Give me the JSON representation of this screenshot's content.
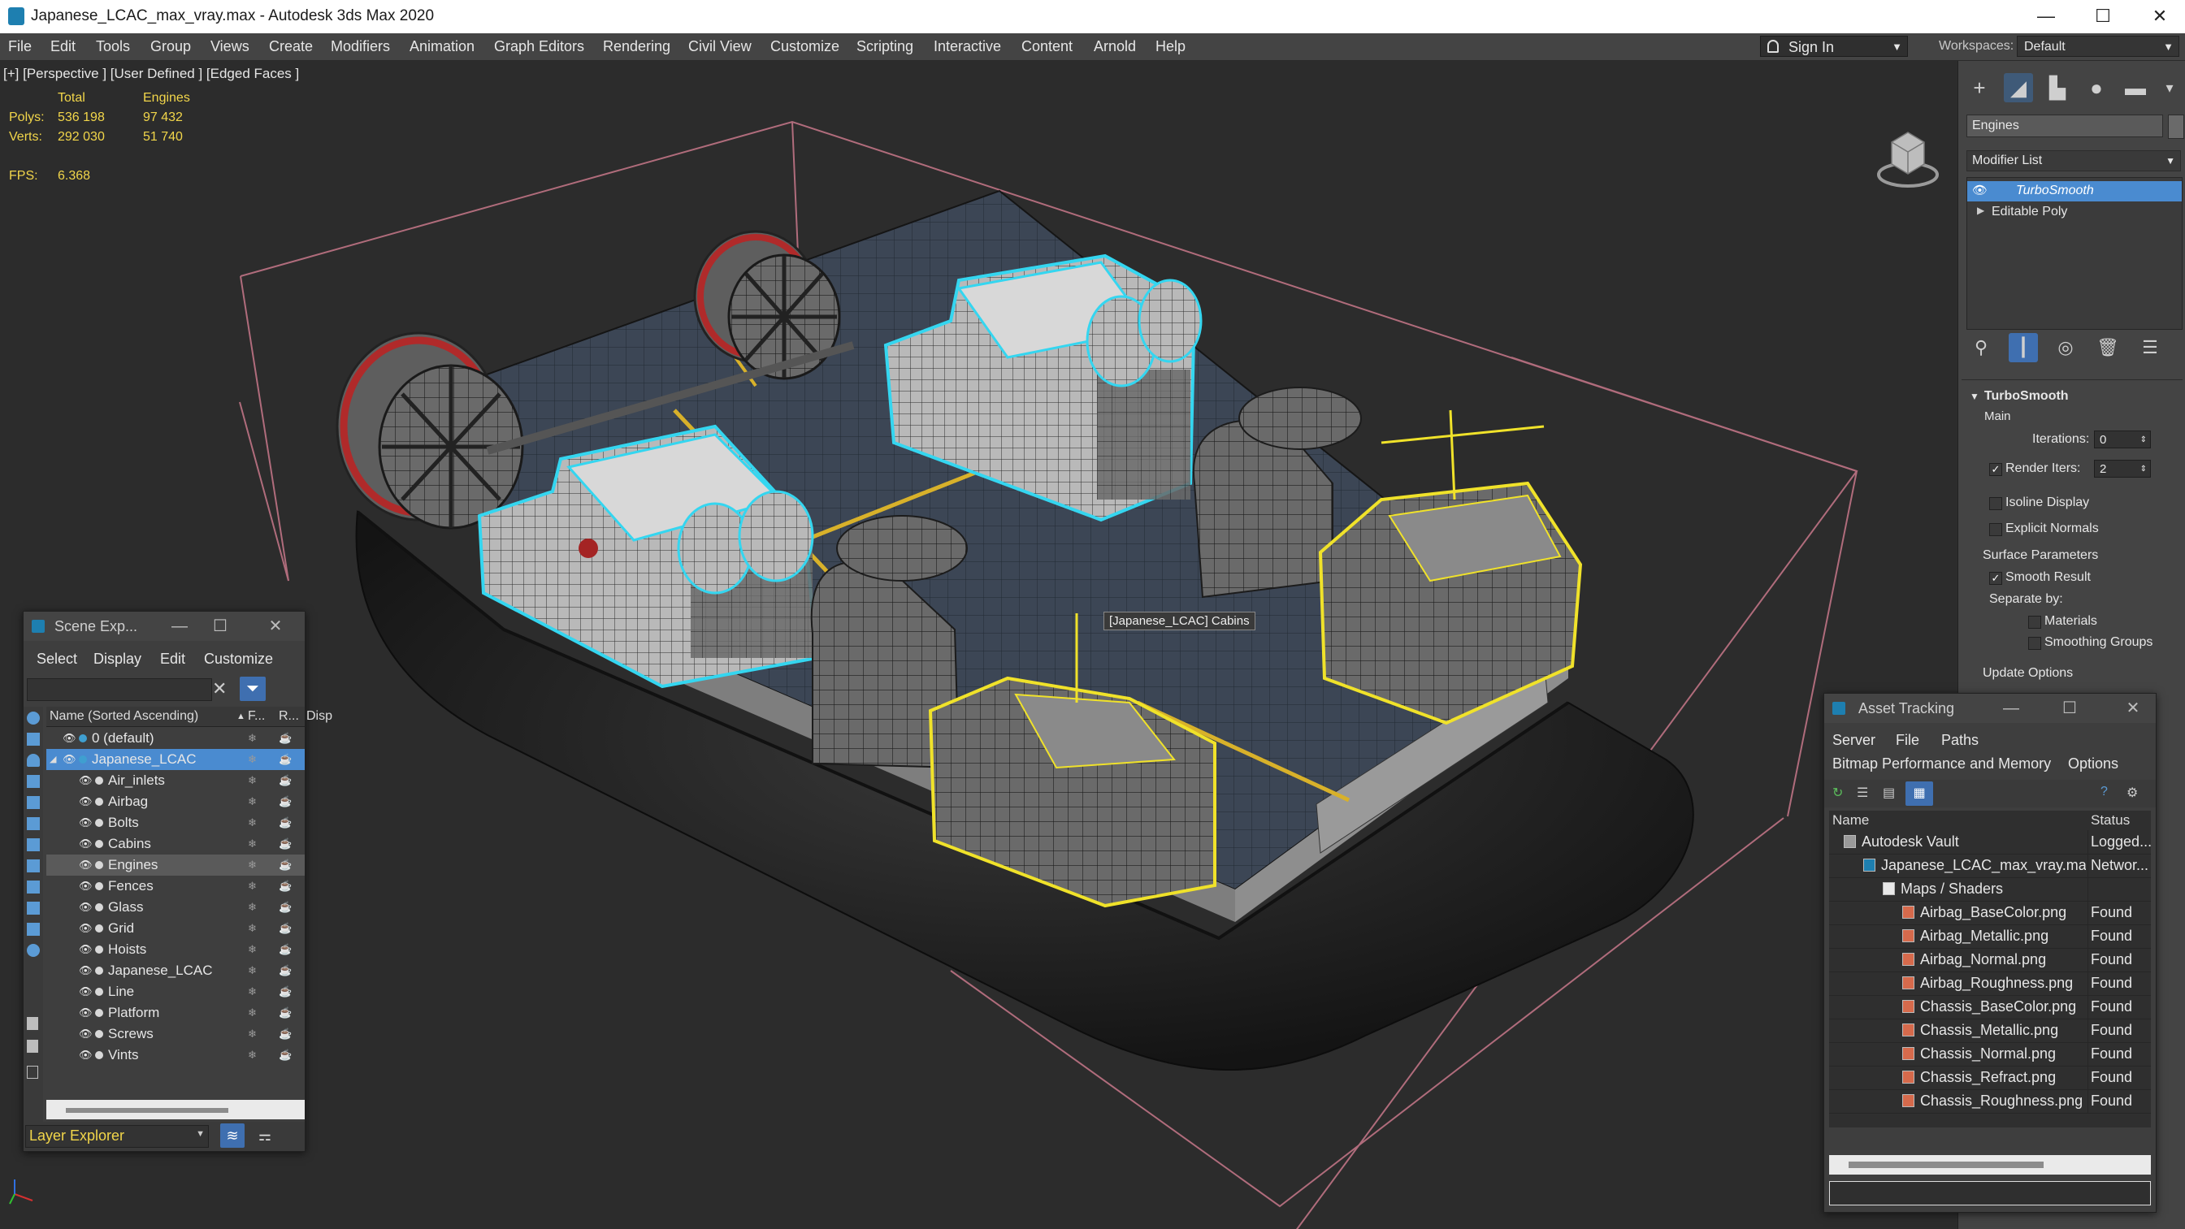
{
  "titlebar": {
    "title": "Japanese_LCAC_max_vray.max - Autodesk 3ds Max 2020",
    "minimize": "—",
    "maximize": "☐",
    "close": "✕"
  },
  "menubar": {
    "items": [
      "File",
      "Edit",
      "Tools",
      "Group",
      "Views",
      "Create",
      "Modifiers",
      "Animation",
      "Graph Editors",
      "Rendering",
      "Civil View",
      "Customize",
      "Scripting",
      "Interactive",
      "Content",
      "Arnold",
      "Help"
    ],
    "signin": "Sign In",
    "workspaces_label": "Workspaces:",
    "workspaces_value": "Default"
  },
  "viewport": {
    "label": "[+] [Perspective ] [User Defined ] [Edged Faces ]",
    "stats": {
      "total_header": "Total",
      "engines_header": "Engines",
      "polys_label": "Polys:",
      "polys_total": "536 198",
      "polys_engines": "97 432",
      "verts_label": "Verts:",
      "verts_total": "292 030",
      "verts_engines": "51 740",
      "fps_label": "FPS:",
      "fps_value": "6.368"
    },
    "tooltip": "[Japanese_LCAC] Cabins"
  },
  "command_panel": {
    "object_name": "Engines",
    "modifier_list": "Modifier List",
    "stack": [
      "TurboSmooth",
      "Editable Poly"
    ],
    "rollout_title": "TurboSmooth",
    "main_label": "Main",
    "iterations_label": "Iterations:",
    "iterations_value": "0",
    "render_iters_label": "Render Iters:",
    "render_iters_value": "2",
    "isoline_display": "Isoline Display",
    "explicit_normals": "Explicit Normals",
    "surface_parameters": "Surface Parameters",
    "smooth_result": "Smooth Result",
    "separate_by": "Separate by:",
    "materials": "Materials",
    "smoothing_groups": "Smoothing Groups",
    "update_options": "Update Options"
  },
  "scene_explorer": {
    "title": "Scene Exp...",
    "menu": [
      "Select",
      "Display",
      "Edit",
      "Customize"
    ],
    "col_name": "Name (Sorted Ascending)",
    "col_f": "F...",
    "col_r": "R...",
    "col_disp": "Disp",
    "rows": [
      {
        "label": "0 (default)",
        "indent": 1
      },
      {
        "label": "Japanese_LCAC",
        "indent": 1
      },
      {
        "label": "Air_inlets",
        "indent": 2
      },
      {
        "label": "Airbag",
        "indent": 2
      },
      {
        "label": "Bolts",
        "indent": 2
      },
      {
        "label": "Cabins",
        "indent": 2
      },
      {
        "label": "Engines",
        "indent": 2
      },
      {
        "label": "Fences",
        "indent": 2
      },
      {
        "label": "Glass",
        "indent": 2
      },
      {
        "label": "Grid",
        "indent": 2
      },
      {
        "label": "Hoists",
        "indent": 2
      },
      {
        "label": "Japanese_LCAC",
        "indent": 2
      },
      {
        "label": "Line",
        "indent": 2
      },
      {
        "label": "Platform",
        "indent": 2
      },
      {
        "label": "Screws",
        "indent": 2
      },
      {
        "label": "Vints",
        "indent": 2
      }
    ],
    "footer_label": "Layer Explorer"
  },
  "asset_tracking": {
    "title": "Asset Tracking",
    "menu1": [
      "Server",
      "File",
      "Paths"
    ],
    "menu2": [
      "Bitmap Performance and Memory",
      "Options"
    ],
    "col_name": "Name",
    "col_status": "Status",
    "rows": [
      {
        "name": "Autodesk Vault",
        "status": "Logged...",
        "indent": 0
      },
      {
        "name": "Japanese_LCAC_max_vray.max",
        "status": "Networ...",
        "indent": 1
      },
      {
        "name": "Maps / Shaders",
        "status": "",
        "indent": 2
      },
      {
        "name": "Airbag_BaseColor.png",
        "status": "Found",
        "indent": 3
      },
      {
        "name": "Airbag_Metallic.png",
        "status": "Found",
        "indent": 3
      },
      {
        "name": "Airbag_Normal.png",
        "status": "Found",
        "indent": 3
      },
      {
        "name": "Airbag_Roughness.png",
        "status": "Found",
        "indent": 3
      },
      {
        "name": "Chassis_BaseColor.png",
        "status": "Found",
        "indent": 3
      },
      {
        "name": "Chassis_Metallic.png",
        "status": "Found",
        "indent": 3
      },
      {
        "name": "Chassis_Normal.png",
        "status": "Found",
        "indent": 3
      },
      {
        "name": "Chassis_Refract.png",
        "status": "Found",
        "indent": 3
      },
      {
        "name": "Chassis_Roughness.png",
        "status": "Found",
        "indent": 3
      }
    ]
  },
  "colors": {
    "selection_cyan": "#34d6f0",
    "selection_yellow": "#f0e22a",
    "stat_yellow": "#f2d64a",
    "active_blue": "#4a8bd0"
  }
}
